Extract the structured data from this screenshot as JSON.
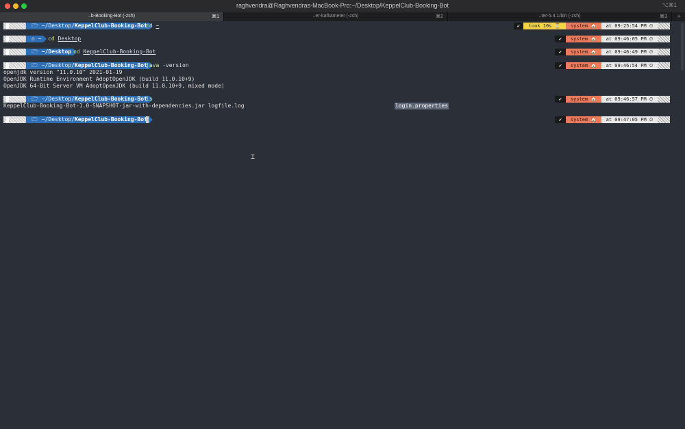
{
  "window": {
    "title": "raghvendra@Raghvendras-MacBook-Pro:~/Desktop/KeppelClub-Booking-Bot",
    "shortcut": "⌥⌘1"
  },
  "tabs": [
    {
      "label": "..b-Booking-Bot (-zsh)",
      "key": "⌘1"
    },
    {
      "label": "..er-kafkameter (-zsh)",
      "key": "⌘2"
    },
    {
      "label": "..ter-5.4.1/bin (-zsh)",
      "key": "⌘3"
    }
  ],
  "tab_add": "+",
  "prompt": {
    "os_glyph": "",
    "home_icon": "~",
    "tilde_dir": "~/Desktop/",
    "desktop_dir": "~/Desktop",
    "project": "KeppelClub-Booking-Bot",
    "home_only": "~"
  },
  "lines": [
    {
      "cmd": "cd",
      "arg": "~",
      "status": "✔",
      "took": "took 10s ⏳",
      "system": "system 🏠",
      "time": "at 09:25:54 PM ⏲"
    },
    {
      "cmd": "cd",
      "arg": "Desktop",
      "status": "✔",
      "system": "system 🏠",
      "time": "at 09:46:05 PM ⏲"
    },
    {
      "cmd": "cd",
      "arg": "KeppelClub-Booking-Bot",
      "status": "✔",
      "system": "system 🏠",
      "time": "at 09:46:49 PM ⏲"
    },
    {
      "cmd": "java",
      "arg": "-version",
      "status": "✔",
      "system": "system 🏠",
      "time": "at 09:46:54 PM ⏲"
    },
    {
      "cmd": "ls",
      "arg": "",
      "status": "✔",
      "system": "system 🏠",
      "time": "at 09:46:57 PM ⏲"
    },
    {
      "cmd": "",
      "arg": "",
      "status": "✔",
      "system": "system 🏠",
      "time": "at 09:47:05 PM ⏲"
    }
  ],
  "java_output": [
    "openjdk version \"11.0.10\" 2021-01-19",
    "OpenJDK Runtime Environment AdoptOpenJDK (build 11.0.10+9)",
    "OpenJDK 64-Bit Server VM AdoptOpenJDK (build 11.0.10+9, mixed mode)"
  ],
  "ls_output": {
    "files": "KeppelClub-Booking-Bot-1.0-SNAPSHOT-jar-with-dependencies.jar logfile.log",
    "highlighted": "login.properties"
  },
  "colors": {
    "background": "#2b2f38",
    "dir_segment": "#2f6fb5",
    "took_segment": "#f5d547",
    "system_segment": "#ec7b5e",
    "command": "#c8e58c"
  }
}
